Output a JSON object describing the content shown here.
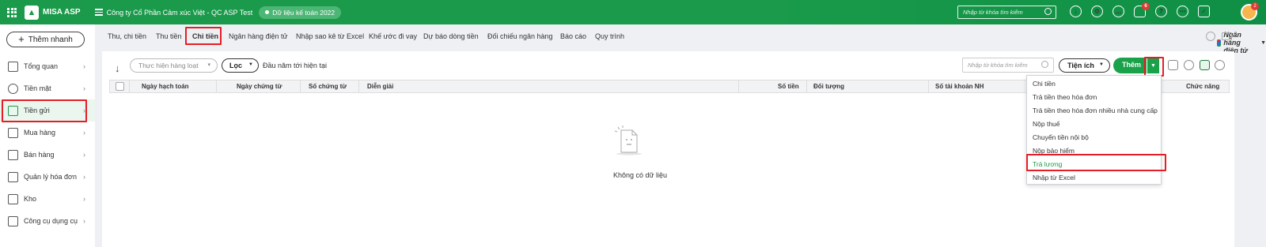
{
  "header": {
    "app_name": "MISA ASP",
    "company": "Công ty Cổ Phần Cảm xúc Việt - QC ASP Test",
    "data_year": "Dữ liệu kế toán 2022",
    "search_placeholder": "Nhập từ khóa tìm kiếm",
    "notification_count": "6",
    "avatar_badge": "2"
  },
  "sidebar": {
    "add_button": "Thêm nhanh",
    "items": [
      {
        "label": "Tổng quan",
        "icon": "dashboard-icon"
      },
      {
        "label": "Tiền mặt",
        "icon": "cash-icon"
      },
      {
        "label": "Tiền gửi",
        "icon": "bank-icon"
      },
      {
        "label": "Mua hàng",
        "icon": "purchase-bag-icon"
      },
      {
        "label": "Bán hàng",
        "icon": "cart-icon"
      },
      {
        "label": "Quản lý hóa đơn",
        "icon": "invoice-icon"
      },
      {
        "label": "Kho",
        "icon": "warehouse-icon"
      },
      {
        "label": "Công cụ dụng cụ",
        "icon": "tools-icon"
      }
    ],
    "active_index": 2
  },
  "tabs": [
    "Thu, chi tiền",
    "Thu tiền",
    "Chi tiền",
    "Ngân hàng điện tử",
    "Nhập sao kê từ Excel",
    "Khế ước đi vay",
    "Dự báo dòng tiền",
    "Đối chiếu ngân hàng",
    "Báo cáo",
    "Quy trình"
  ],
  "active_tab": "Chi tiền",
  "ebank_label": "Ngân hàng điện tử",
  "toolbar": {
    "filter_placeholder": "Thực hiện hàng loạt",
    "filter_button": "Lọc",
    "period": "Đầu năm tới hiện tại",
    "search_placeholder": "Nhập từ khóa tìm kiếm",
    "utilities_button": "Tiện ích",
    "add_button": "Thêm"
  },
  "table": {
    "columns": [
      "Ngày hạch toán",
      "Ngày chứng từ",
      "Số chứng từ",
      "Diễn giải",
      "Số tiền",
      "Đối tượng",
      "Số tài khoản NH",
      "Chức năng"
    ],
    "empty_text": "Không có dữ liệu"
  },
  "add_menu": {
    "items": [
      "Chi tiền",
      "Trả tiền theo hóa đơn",
      "Trả tiền theo hóa đơn nhiều nhà cung cấp",
      "Nộp thuế",
      "Chuyển tiền nội bộ",
      "Nộp bảo hiểm",
      "Trả lương",
      "Nhập từ Excel"
    ],
    "highlighted": "Trả lương"
  },
  "colors": {
    "brand_green": "#1a9a4a",
    "highlight_red": "#e41e26"
  }
}
